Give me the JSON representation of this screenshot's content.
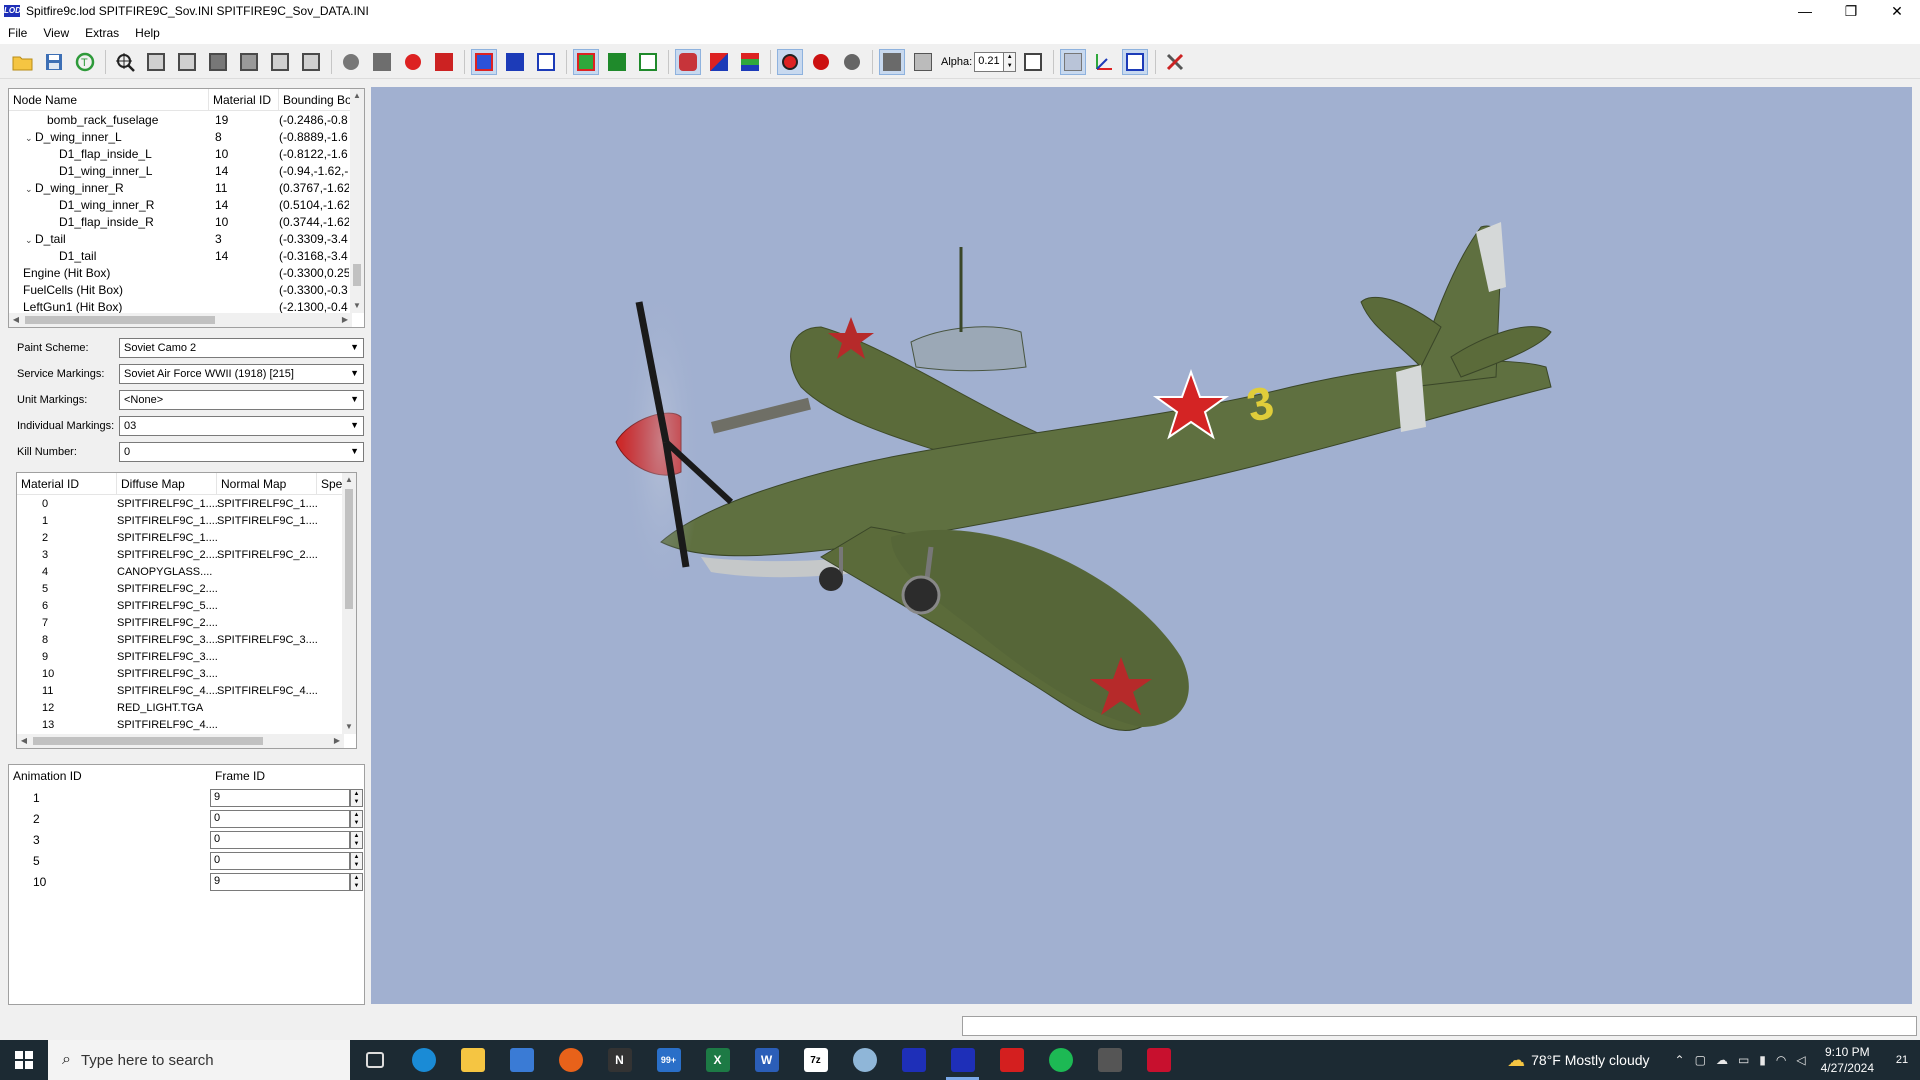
{
  "window": {
    "app_icon_text": "LOD",
    "title": "Spitfire9c.lod  SPITFIRE9C_Sov.INI  SPITFIRE9C_Sov_DATA.INI",
    "minimize": "—",
    "restore": "❐",
    "close": "✕"
  },
  "menu": [
    "File",
    "View",
    "Extras",
    "Help"
  ],
  "toolbar": {
    "alpha_label": "Alpha:",
    "alpha_value": "0.21"
  },
  "node_tree": {
    "headers": [
      "Node Name",
      "Material ID",
      "Bounding Bo"
    ],
    "rows": [
      {
        "name": "bomb_rack_fuselage",
        "mat": "19",
        "bbox": "(-0.2486,-0.8",
        "indent": 2,
        "expander": ""
      },
      {
        "name": "D_wing_inner_L",
        "mat": "8",
        "bbox": "(-0.8889,-1.6",
        "indent": 1,
        "expander": "v"
      },
      {
        "name": "D1_flap_inside_L",
        "mat": "10",
        "bbox": "(-0.8122,-1.6",
        "indent": 3,
        "expander": ""
      },
      {
        "name": "D1_wing_inner_L",
        "mat": "14",
        "bbox": "(-0.94,-1.62,-",
        "indent": 3,
        "expander": ""
      },
      {
        "name": "D_wing_inner_R",
        "mat": "11",
        "bbox": "(0.3767,-1.62",
        "indent": 1,
        "expander": "v"
      },
      {
        "name": "D1_wing_inner_R",
        "mat": "14",
        "bbox": "(0.5104,-1.62",
        "indent": 3,
        "expander": ""
      },
      {
        "name": "D1_flap_inside_R",
        "mat": "10",
        "bbox": "(0.3744,-1.62",
        "indent": 3,
        "expander": ""
      },
      {
        "name": "D_tail",
        "mat": "3",
        "bbox": "(-0.3309,-3.4",
        "indent": 1,
        "expander": "v"
      },
      {
        "name": "D1_tail",
        "mat": "14",
        "bbox": "(-0.3168,-3.4",
        "indent": 3,
        "expander": ""
      },
      {
        "name": "Engine (Hit Box)",
        "mat": "",
        "bbox": "(-0.3300,0.25",
        "indent": 0,
        "expander": ""
      },
      {
        "name": "FuelCells (Hit Box)",
        "mat": "",
        "bbox": "(-0.3300,-0.3",
        "indent": 0,
        "expander": ""
      },
      {
        "name": "LeftGun1 (Hit Box)",
        "mat": "",
        "bbox": "(-2.1300,-0.4",
        "indent": 0,
        "expander": ""
      }
    ]
  },
  "properties": {
    "paint_scheme_label": "Paint Scheme:",
    "paint_scheme_value": "Soviet Camo 2",
    "service_markings_label": "Service Markings:",
    "service_markings_value": "Soviet Air Force WWII (1918) [215]",
    "unit_markings_label": "Unit Markings:",
    "unit_markings_value": "<None>",
    "individual_markings_label": "Individual Markings:",
    "individual_markings_value": "03",
    "kill_number_label": "Kill Number:",
    "kill_number_value": "0"
  },
  "materials": {
    "headers": [
      "Material ID",
      "Diffuse Map",
      "Normal Map",
      "Spe"
    ],
    "rows": [
      [
        "0",
        "SPITFIRELF9C_1....",
        "SPITFIRELF9C_1...."
      ],
      [
        "1",
        "SPITFIRELF9C_1....",
        "SPITFIRELF9C_1...."
      ],
      [
        "2",
        "SPITFIRELF9C_1....",
        ""
      ],
      [
        "3",
        "SPITFIRELF9C_2....",
        "SPITFIRELF9C_2...."
      ],
      [
        "4",
        "CANOPYGLASS....",
        ""
      ],
      [
        "5",
        "SPITFIRELF9C_2....",
        ""
      ],
      [
        "6",
        "SPITFIRELF9C_5....",
        ""
      ],
      [
        "7",
        "SPITFIRELF9C_2....",
        ""
      ],
      [
        "8",
        "SPITFIRELF9C_3....",
        "SPITFIRELF9C_3...."
      ],
      [
        "9",
        "SPITFIRELF9C_3....",
        ""
      ],
      [
        "10",
        "SPITFIRELF9C_3....",
        ""
      ],
      [
        "11",
        "SPITFIRELF9C_4....",
        "SPITFIRELF9C_4...."
      ],
      [
        "12",
        "RED_LIGHT.TGA",
        ""
      ],
      [
        "13",
        "SPITFIRELF9C_4....",
        ""
      ]
    ]
  },
  "animations": {
    "headers": [
      "Animation ID",
      "Frame ID"
    ],
    "rows": [
      {
        "id": "1",
        "frame": "9"
      },
      {
        "id": "2",
        "frame": "0"
      },
      {
        "id": "3",
        "frame": "0"
      },
      {
        "id": "5",
        "frame": "0"
      },
      {
        "id": "10",
        "frame": "9"
      }
    ]
  },
  "viewport": {
    "background": "#a1b0d0",
    "tail_number": "3"
  },
  "taskbar": {
    "search_placeholder": "Type here to search",
    "mail_badge": "99+",
    "weather": "78°F  Mostly cloudy",
    "time": "9:10 PM",
    "date": "4/27/2024",
    "notification_count": "21"
  }
}
